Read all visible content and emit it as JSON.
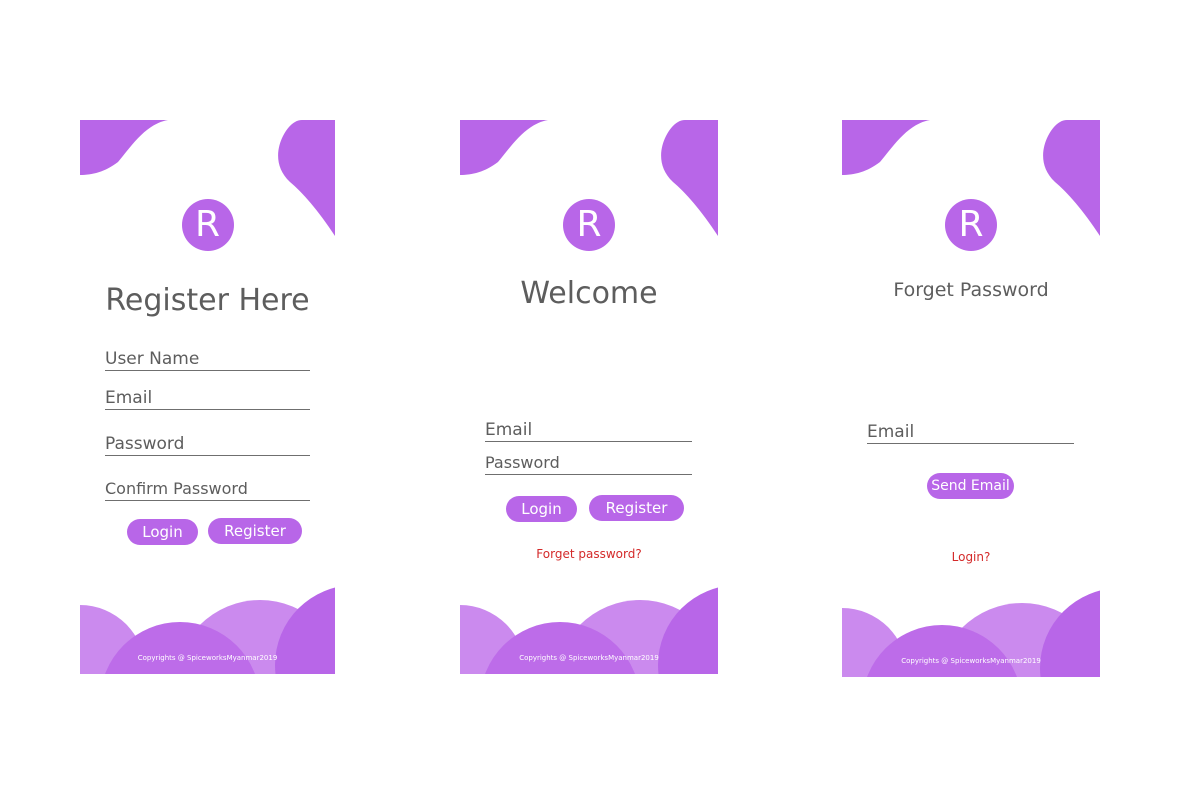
{
  "colors": {
    "accent": "#b866e8",
    "accent_light": "#cb8aee",
    "accent_dark": "#b063e6",
    "link": "#d42a2a",
    "text": "#5d5d5d"
  },
  "register": {
    "logo_letter": "R",
    "title": "Register Here",
    "username_placeholder": "User Name",
    "email_placeholder": "Email",
    "password_placeholder": "Password",
    "confirm_password_placeholder": "Confirm Password",
    "login_label": "Login",
    "register_label": "Register",
    "copyright": "Copyrights @ SpiceworksMyanmar2019"
  },
  "welcome": {
    "logo_letter": "R",
    "title": "Welcome",
    "email_placeholder": "Email",
    "password_placeholder": "Password",
    "login_label": "Login",
    "register_label": "Register",
    "forget_link": "Forget password?",
    "copyright": "Copyrights @ SpiceworksMyanmar2019"
  },
  "forget": {
    "logo_letter": "R",
    "title": "Forget Password",
    "email_placeholder": "Email",
    "send_label": "Send Email",
    "login_link": "Login?",
    "copyright": "Copyrights @ SpiceworksMyanmar2019"
  }
}
